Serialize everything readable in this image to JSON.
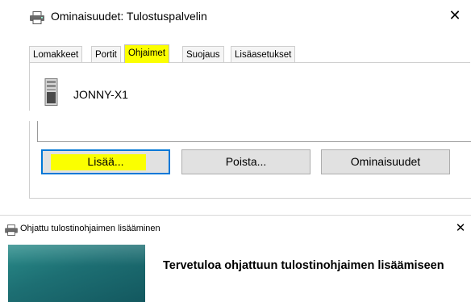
{
  "properties_dialog": {
    "title": "Ominaisuudet: Tulostuspalvelin",
    "close_glyph": "✕",
    "tabs": [
      {
        "label": "Lomakkeet"
      },
      {
        "label": "Portit"
      },
      {
        "label": "Ohjaimet",
        "active": true
      },
      {
        "label": "Suojaus"
      },
      {
        "label": "Lisäasetukset"
      }
    ],
    "server_name": "JONNY-X1",
    "buttons": {
      "add": "Lisää...",
      "remove": "Poista...",
      "properties": "Ominaisuudet"
    },
    "highlight_color": "#fbff00",
    "focus_color": "#0078d7"
  },
  "wizard": {
    "title": "Ohjattu tulostinohjaimen lisääminen",
    "close_glyph": "✕",
    "heading": "Tervetuloa ohjattuun tulostinohjaimen lisäämiseen",
    "banner_color": "#1d6f73"
  }
}
